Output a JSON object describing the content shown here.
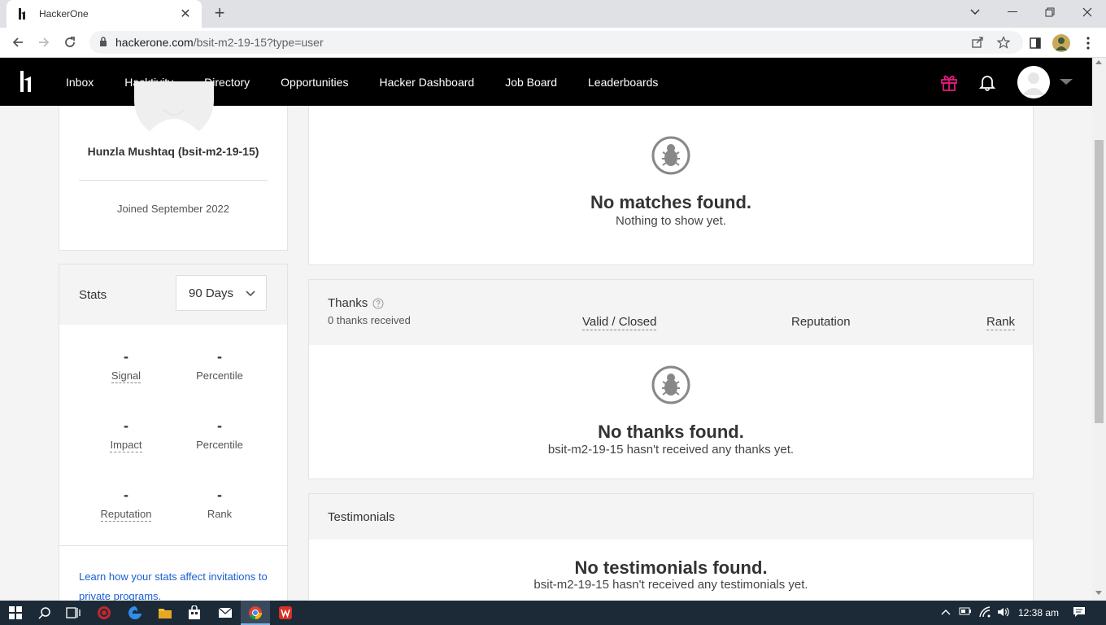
{
  "browser": {
    "tab_title": "HackerOne",
    "url_host": "hackerone.com",
    "url_path": "/bsit-m2-19-15?type=user"
  },
  "nav": {
    "links": [
      "Inbox",
      "Hacktivity",
      "Directory",
      "Opportunities",
      "Hacker Dashboard",
      "Job Board",
      "Leaderboards"
    ],
    "gift_color": "#e0197d"
  },
  "profile": {
    "name": "Hunzla Mushtaq (bsit-m2-19-15)",
    "joined": "Joined September 2022"
  },
  "stats": {
    "title": "Stats",
    "range": "90 Days",
    "items": [
      {
        "value": "-",
        "label": "Signal"
      },
      {
        "value": "-",
        "label": "Percentile"
      },
      {
        "value": "-",
        "label": "Impact"
      },
      {
        "value": "-",
        "label": "Percentile"
      },
      {
        "value": "-",
        "label": "Reputation"
      },
      {
        "value": "-",
        "label": "Rank"
      }
    ],
    "link": "Learn how your stats affect invitations to private programs."
  },
  "matches": {
    "title": "No matches found.",
    "subtitle": "Nothing to show yet."
  },
  "thanks": {
    "title": "Thanks",
    "count": "0 thanks received",
    "columns": [
      "Valid / Closed",
      "Reputation",
      "Rank"
    ],
    "empty_title": "No thanks found.",
    "empty_subtitle": "bsit-m2-19-15 hasn't received any thanks yet."
  },
  "testimonials": {
    "title": "Testimonials",
    "empty_title": "No testimonials found.",
    "empty_subtitle": "bsit-m2-19-15 hasn't received any testimonials yet."
  },
  "taskbar": {
    "clock": "12:38 am"
  },
  "colors": {
    "link": "#1a5fd1",
    "nav_bg": "#000000"
  }
}
